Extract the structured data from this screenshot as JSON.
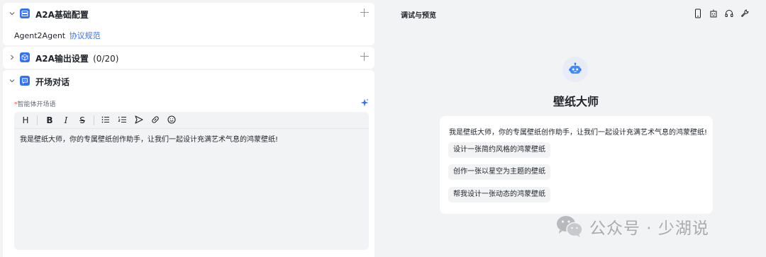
{
  "left": {
    "sections": {
      "a2a_config": {
        "title": "A2A基础配置",
        "protocol_prefix": "Agent2Agent",
        "protocol_link": "协议规范"
      },
      "a2a_output": {
        "title": "A2A输出设置",
        "count": "(0/20)"
      },
      "opening": {
        "title": "开场对话",
        "required_mark": "*",
        "field_label": "智能体开场语",
        "toolbar": {
          "heading": "H",
          "bold": "B",
          "italic": "I",
          "strike": "S"
        },
        "editor_text": "我是壁纸大师，你的专属壁纸创作助手，让我们一起设计充满艺术气息的鸿蒙壁纸!"
      }
    }
  },
  "right": {
    "title": "调试与预览",
    "bot_name": "壁纸大师",
    "greeting": "我是壁纸大师，你的专属壁纸创作助手，让我们一起设计充满艺术气息的鸿蒙壁纸!",
    "suggestions": [
      "设计一张简约风格的鸿蒙壁纸",
      "创作一张以星空为主题的壁纸",
      "帮我设计一张动态的鸿蒙壁纸"
    ],
    "icons": [
      "phone-icon",
      "robot-settings-icon",
      "headset-icon",
      "wrench-icon"
    ]
  },
  "watermark": {
    "text": "公众号 · 少湖说"
  },
  "colors": {
    "accent": "#3370ff",
    "panel_bg": "#ffffff",
    "page_bg": "#f2f3f5",
    "required": "#f54a45"
  }
}
